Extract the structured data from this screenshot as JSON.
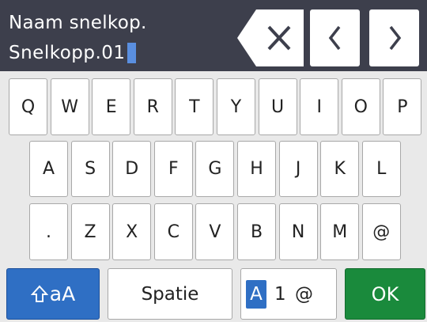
{
  "header": {
    "title": "Naam snelkop.",
    "entry_value": "Snelkopp.01"
  },
  "nav": {
    "backspace_icon": "backspace-icon",
    "left_icon": "chevron-left-icon",
    "right_icon": "chevron-right-icon"
  },
  "keyboard": {
    "rows": [
      [
        "Q",
        "W",
        "E",
        "R",
        "T",
        "Y",
        "U",
        "I",
        "O",
        "P"
      ],
      [
        "A",
        "S",
        "D",
        "F",
        "G",
        "H",
        "J",
        "K",
        "L"
      ],
      [
        ".",
        "Z",
        "X",
        "C",
        "V",
        "B",
        "N",
        "M",
        "@"
      ]
    ]
  },
  "bottom": {
    "shift_icon": "shift-icon",
    "shift_label": "aA",
    "space_label": "Spatie",
    "mode_active": "A",
    "mode_rest": "1 @",
    "ok_label": "OK"
  },
  "colors": {
    "header_bg": "#3d3f4c",
    "accent_blue": "#2f6fc4",
    "ok_green": "#1a8a3c",
    "background": "#e9e9e9"
  }
}
